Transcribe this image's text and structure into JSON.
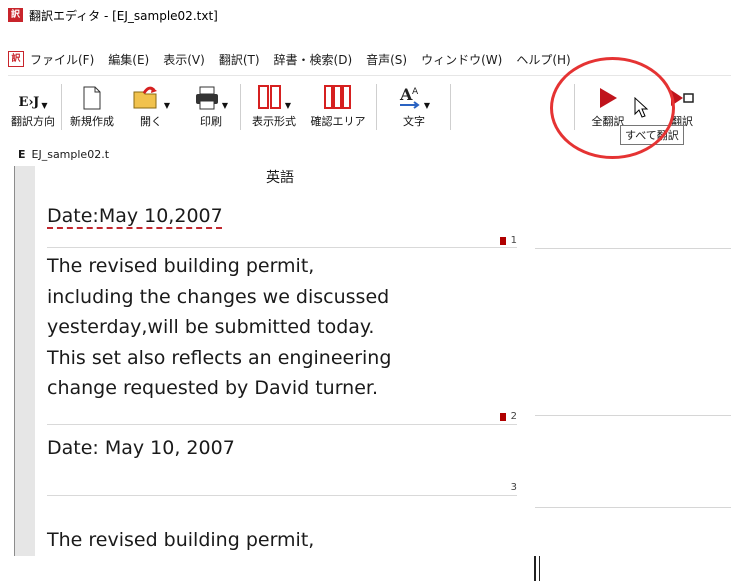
{
  "window": {
    "title": "翻訳エディタ - [EJ_sample02.txt]"
  },
  "menu": [
    "ファイル(F)",
    "編集(E)",
    "表示(V)",
    "翻訳(T)",
    "辞書・検索(D)",
    "音声(S)",
    "ウィンドウ(W)",
    "ヘルプ(H)"
  ],
  "toolbar": {
    "direction_label": "翻訳方向",
    "direction_icon_text": "E›J",
    "new_label": "新規作成",
    "open_label": "開く",
    "print_label": "印刷",
    "display_label": "表示形式",
    "confirm_label": "確認エリア",
    "text_label": "文字",
    "translate_all_label": "全翻訳",
    "translate_label": "翻訳"
  },
  "tooltip": {
    "text": "すべて翻訳"
  },
  "doc_tab": {
    "marker": "E",
    "label": "EJ_sample02.t"
  },
  "editor": {
    "column_header": "英語",
    "segments": [
      {
        "lines": [
          "Date:May 10,2007"
        ],
        "number": "1",
        "flag": true
      },
      {
        "lines": [
          "The revised building permit,",
          "including the changes we discussed",
          "yesterday,will be submitted today.",
          "This set also reflects an engineering",
          "change requested by David turner."
        ],
        "number": "2",
        "flag": true
      },
      {
        "lines": [
          "Date: May 10, 2007"
        ],
        "number": "3",
        "flag": false
      },
      {
        "lines": [
          "The revised building permit,"
        ],
        "number": "",
        "flag": false
      }
    ]
  },
  "colors": {
    "accent_red": "#e53333",
    "play_red": "#c0141c",
    "underline": "#c0282f"
  }
}
